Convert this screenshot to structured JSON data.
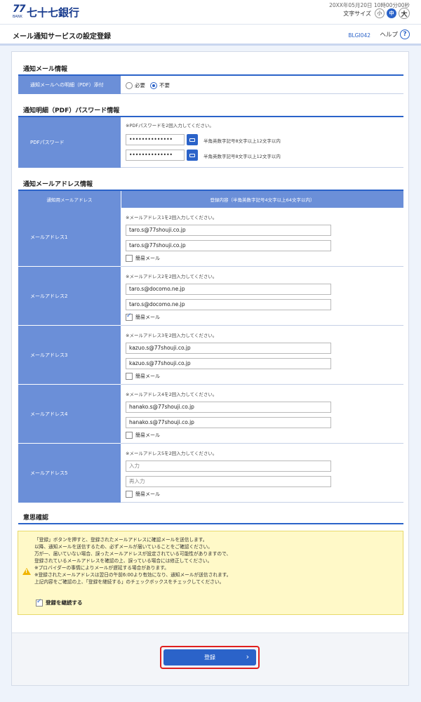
{
  "header": {
    "logo_number": "77",
    "logo_bank": "BANK",
    "bank_name": "七十七銀行",
    "datetime": "20XX年05月20日 10時00分00秒",
    "font_size_label": "文字サイズ",
    "font_small": "小",
    "font_medium": "中",
    "font_large": "大"
  },
  "subheader": {
    "title": "メール通知サービスの設定登録",
    "screen_id": "BLGI042",
    "help_label": "ヘルプ",
    "help_icon_text": "?"
  },
  "section_notice_mail": {
    "title": "通知メール情報",
    "row_label": "通知メールへの明細（PDF）添付",
    "option_required": "必要",
    "option_not_required": "不要",
    "selected": "不要"
  },
  "section_pdf_password": {
    "title": "通知明細（PDF）パスワード情報",
    "row_label": "PDFパスワード",
    "note": "※PDFパスワードを2回入力してください。",
    "password_value": "••••••••••••••",
    "password_confirm_value": "••••••••••••••",
    "hint": "半角英数字記号8文字以上12文字以内"
  },
  "section_addresses": {
    "title": "通知メールアドレス情報",
    "col_label": "通知用メールアドレス",
    "col_content": "登録内容（半角英数字記号4文字以上64文字以内）",
    "simple_mail_label": "簡易メール",
    "rows": [
      {
        "label": "メールアドレス1",
        "note": "※メールアドレス1を2回入力してください。",
        "value": "taro.s@77shouji.co.jp",
        "confirm": "taro.s@77shouji.co.jp",
        "simple": false
      },
      {
        "label": "メールアドレス2",
        "note": "※メールアドレス2を2回入力してください。",
        "value": "taro.s@docomo.ne.jp",
        "confirm": "taro.s@docomo.ne.jp",
        "simple": true
      },
      {
        "label": "メールアドレス3",
        "note": "※メールアドレス3を2回入力してください。",
        "value": "kazuo.s@77shouji.co.jp",
        "confirm": "kazuo.s@77shouji.co.jp",
        "simple": false
      },
      {
        "label": "メールアドレス4",
        "note": "※メールアドレス4を2回入力してください。",
        "value": "hanako.s@77shouji.co.jp",
        "confirm": "hanako.s@77shouji.co.jp",
        "simple": false
      },
      {
        "label": "メールアドレス5",
        "note": "※メールアドレス5を2回入力してください。",
        "value": "",
        "confirm": "",
        "placeholder": "入力",
        "confirm_placeholder": "再入力",
        "simple": false
      }
    ]
  },
  "section_confirm": {
    "title": "意思確認",
    "lines": [
      "「登録」ボタンを押すと、登録されたメールアドレスに確認メールを送信します。",
      "以降、通知メールを送信するため、必ずメールが届いていることをご確認ください。",
      "万が一、届いていない場合、誤ったメールアドレスが設定されている可能性がありますので、",
      "登録されているメールアドレスを確認の上、誤っている場合には修正してください。",
      "※プロバイダーの事情によりメールが遅延する場合があります。",
      "※登録されたメールアドレスは翌日の午前6:00より有効になり、通知メールが送信されます。",
      "上記内容をご確認の上、「登録を継続する」のチェックボックスをチェックしてください。"
    ],
    "continue_label": "登録を継続する",
    "continue_checked": true
  },
  "footer": {
    "submit_label": "登録",
    "submit_chevron": "›"
  }
}
